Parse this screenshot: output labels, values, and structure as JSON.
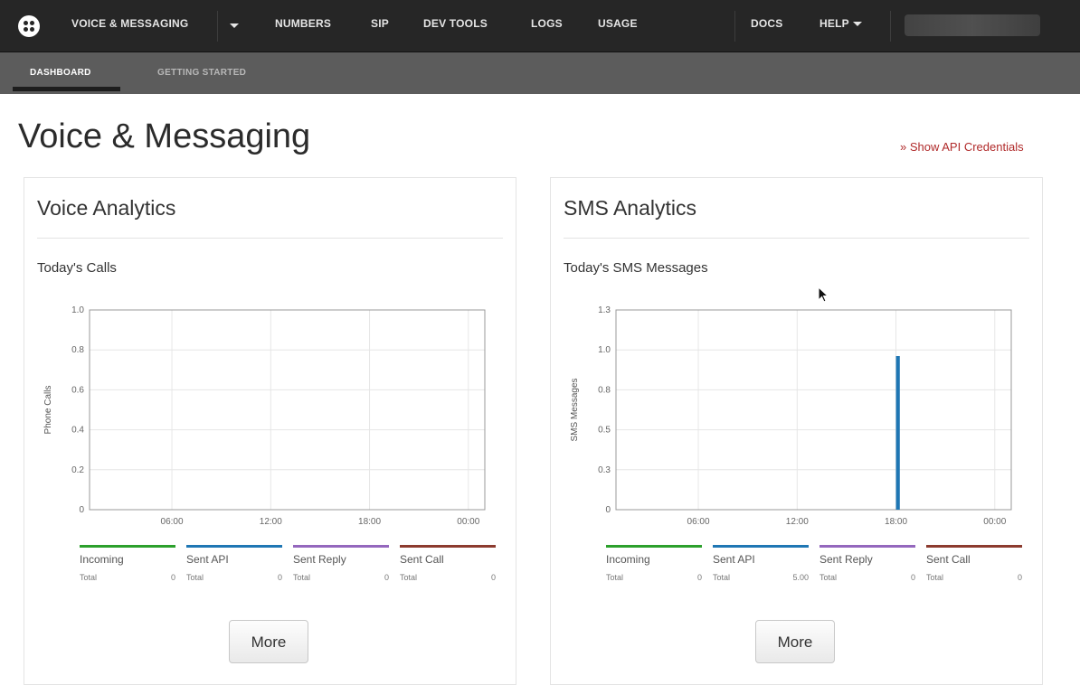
{
  "nav": {
    "product": "VOICE & MESSAGING",
    "items": [
      "NUMBERS",
      "SIP",
      "DEV TOOLS",
      "LOGS",
      "USAGE"
    ],
    "docs": "DOCS",
    "help": "HELP"
  },
  "subnav": {
    "tabs": [
      "DASHBOARD",
      "GETTING STARTED"
    ],
    "active": "DASHBOARD"
  },
  "page": {
    "title": "Voice & Messaging",
    "api_credentials_link": "» Show API Credentials"
  },
  "voice": {
    "title": "Voice Analytics",
    "chart_title": "Today's Calls",
    "more_label": "More",
    "legend": [
      {
        "label": "Incoming",
        "total_label": "Total",
        "total": "0",
        "color": "#2ca02c"
      },
      {
        "label": "Sent API",
        "total_label": "Total",
        "total": "0",
        "color": "#1f77b4"
      },
      {
        "label": "Sent Reply",
        "total_label": "Total",
        "total": "0",
        "color": "#9467bd"
      },
      {
        "label": "Sent Call",
        "total_label": "Total",
        "total": "0",
        "color": "#8c3b2f"
      }
    ]
  },
  "sms": {
    "title": "SMS Analytics",
    "chart_title": "Today's SMS Messages",
    "more_label": "More",
    "legend": [
      {
        "label": "Incoming",
        "total_label": "Total",
        "total": "0",
        "color": "#2ca02c"
      },
      {
        "label": "Sent API",
        "total_label": "Total",
        "total": "5.00",
        "color": "#1f77b4"
      },
      {
        "label": "Sent Reply",
        "total_label": "Total",
        "total": "0",
        "color": "#9467bd"
      },
      {
        "label": "Sent Call",
        "total_label": "Total",
        "total": "0",
        "color": "#8c3b2f"
      }
    ]
  },
  "chart_data": [
    {
      "type": "bar",
      "title": "Today's Calls",
      "xlabel": "",
      "ylabel": "Phone Calls",
      "x_ticks": [
        "06:00",
        "12:00",
        "18:00",
        "00:00"
      ],
      "y_ticks": [
        "0",
        "0.2",
        "0.4",
        "0.6",
        "0.8",
        "1.0"
      ],
      "ylim": [
        0,
        1.0
      ],
      "grid": true,
      "series": []
    },
    {
      "type": "bar",
      "title": "Today's SMS Messages",
      "xlabel": "",
      "ylabel": "SMS Messages",
      "x_ticks": [
        "06:00",
        "12:00",
        "18:00",
        "00:00"
      ],
      "y_ticks": [
        "0",
        "0.3",
        "0.5",
        "0.8",
        "1.0",
        "1.3"
      ],
      "ylim": [
        0,
        1.3
      ],
      "grid": true,
      "series": [
        {
          "name": "Sent API",
          "color": "#1f77b4",
          "bars": [
            {
              "time": "18:03",
              "value": 1
            },
            {
              "time": "18:05",
              "value": 1
            },
            {
              "time": "18:07",
              "value": 1
            },
            {
              "time": "18:09",
              "value": 1
            },
            {
              "time": "18:11",
              "value": 1
            }
          ]
        }
      ]
    }
  ]
}
